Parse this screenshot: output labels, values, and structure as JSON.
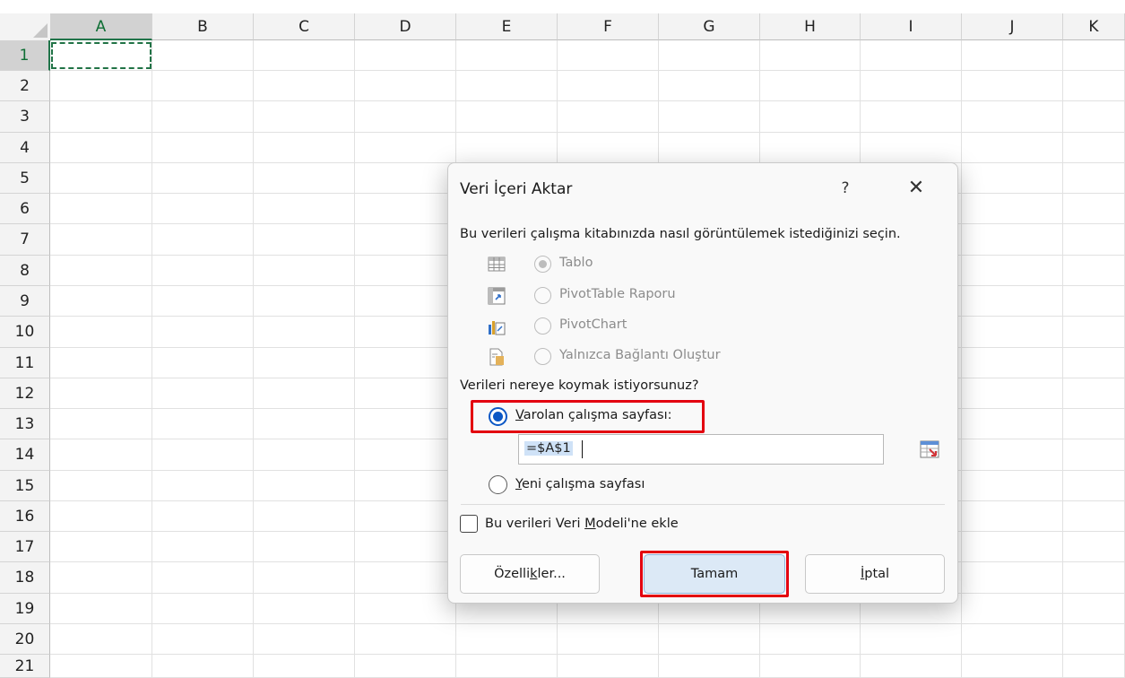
{
  "sheet": {
    "columns": [
      "A",
      "B",
      "C",
      "D",
      "E",
      "F",
      "G",
      "H",
      "I",
      "J",
      "K"
    ],
    "rows": [
      "1",
      "2",
      "3",
      "4",
      "5",
      "6",
      "7",
      "8",
      "9",
      "10",
      "11",
      "12",
      "13",
      "14",
      "15",
      "16",
      "17",
      "18",
      "19",
      "20",
      "21"
    ],
    "selected_column": "A",
    "selected_row": "1"
  },
  "dialog": {
    "title": "Veri İçeri Aktar",
    "help": "?",
    "close": "✕",
    "prompt_view": "Bu verileri çalışma kitabınızda nasıl görüntülemek istediğinizi seçin.",
    "view_options": [
      {
        "label": "Tablo",
        "icon": "table-icon",
        "selected": true,
        "enabled": false
      },
      {
        "label": "PivotTable Raporu",
        "icon": "pivottable-icon",
        "selected": false,
        "enabled": false
      },
      {
        "label": "PivotChart",
        "icon": "pivotchart-icon",
        "selected": false,
        "enabled": false
      },
      {
        "label": "Yalnızca Bağlantı Oluştur",
        "icon": "connection-only-icon",
        "selected": false,
        "enabled": false
      }
    ],
    "prompt_location": "Verileri nereye koymak istiyorsunuz?",
    "existing_sheet": {
      "accel": "V",
      "rest": "arolan çalışma sayfası:",
      "selected": true
    },
    "range_value": "=$A$1",
    "new_sheet": {
      "accel": "Y",
      "rest": "eni çalışma sayfası",
      "selected": false
    },
    "data_model": {
      "pre": "Bu verileri Veri ",
      "accel": "M",
      "post": "odeli'ne ekle",
      "checked": false
    },
    "buttons": {
      "properties": {
        "pre": "Özelli",
        "accel": "k",
        "post": "ler..."
      },
      "ok": "Tamam",
      "cancel": {
        "accel": "İ",
        "post": "ptal"
      }
    },
    "highlight_color": "#e3000f",
    "accent_color": "#0b57c5"
  }
}
